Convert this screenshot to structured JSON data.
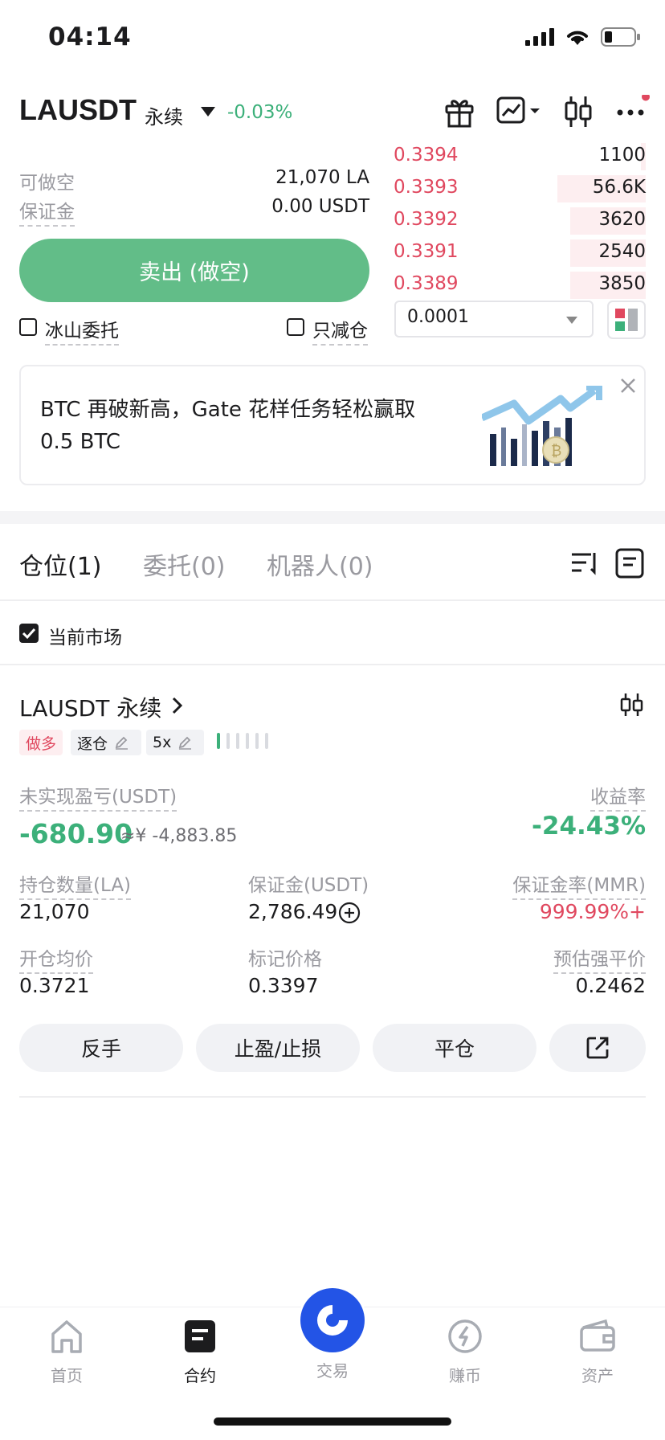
{
  "status_bar": {
    "time": "04:14"
  },
  "header": {
    "pair": "LAUSDT",
    "type": "永续",
    "change": "-0.03%",
    "icons": [
      "gift-icon",
      "chart-line-icon",
      "candlestick-icon",
      "more-icon"
    ]
  },
  "order_form": {
    "available_label": "可做空",
    "available_value": "21,070 LA",
    "margin_label": "保证金",
    "margin_value": "0.00 USDT",
    "sell_button": "卖出 (做空)",
    "iceberg_label": "冰山委托",
    "reduce_only_label": "只减仓"
  },
  "order_book": {
    "asks": [
      {
        "price": "0.3394",
        "qty": "1100",
        "depth": 0.05
      },
      {
        "price": "0.3393",
        "qty": "56.6K",
        "depth": 1.0
      },
      {
        "price": "0.3392",
        "qty": "3620",
        "depth": 0.85
      },
      {
        "price": "0.3391",
        "qty": "2540",
        "depth": 0.85
      },
      {
        "price": "0.3389",
        "qty": "3850",
        "depth": 0.85
      }
    ],
    "tick_size": "0.0001"
  },
  "banner": {
    "text": "BTC 再破新高，Gate 花样任务轻松赢取 0.5 BTC"
  },
  "tabs": [
    {
      "label": "仓位(1)",
      "active": true
    },
    {
      "label": "委托(0)",
      "active": false
    },
    {
      "label": "机器人(0)",
      "active": false
    }
  ],
  "filter": {
    "current_market_label": "当前市场",
    "checked": true
  },
  "position": {
    "title": "LAUSDT 永续",
    "side_tag": "做多",
    "mode_tag": "逐仓",
    "leverage_tag": "5x",
    "risk_level": 0.2,
    "pnl_label": "未实现盈亏(USDT)",
    "pnl_value": "-680.90",
    "pnl_cny": "≈¥ -4,883.85",
    "roe_label": "收益率",
    "roe_value": "-24.43%",
    "qty_label": "持仓数量(LA)",
    "qty_value": "21,070",
    "margin_label": "保证金(USDT)",
    "margin_value": "2,786.49",
    "mmr_label": "保证金率(MMR)",
    "mmr_value": "999.99%+",
    "entry_label": "开仓均价",
    "entry_value": "0.3721",
    "mark_label": "标记价格",
    "mark_value": "0.3397",
    "liq_label": "预估强平价",
    "liq_value": "0.2462",
    "actions": [
      "反手",
      "止盈/止损",
      "平仓"
    ]
  },
  "nav": [
    {
      "label": "首页",
      "icon": "home-icon"
    },
    {
      "label": "合约",
      "icon": "futures-icon"
    },
    {
      "label": "交易",
      "icon": "trade-icon"
    },
    {
      "label": "赚币",
      "icon": "earn-icon"
    },
    {
      "label": "资产",
      "icon": "wallet-icon"
    }
  ],
  "colors": {
    "green": "#3cb07a",
    "red": "#e0485f",
    "brand": "#2354e6"
  }
}
